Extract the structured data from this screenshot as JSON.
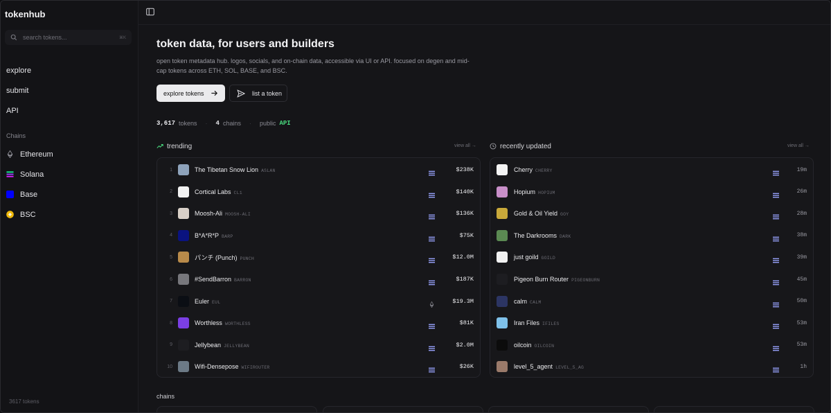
{
  "app": {
    "brand": "tokenhub",
    "footer": "3617 tokens"
  },
  "search": {
    "placeholder": "search tokens...",
    "shortcut": "⌘K"
  },
  "nav": [
    {
      "label": "explore"
    },
    {
      "label": "submit"
    },
    {
      "label": "API"
    }
  ],
  "sidebar_chains": {
    "heading": "Chains",
    "items": [
      {
        "label": "Ethereum",
        "icon": "ethereum-icon",
        "color": "#8a8a92"
      },
      {
        "label": "Solana",
        "icon": "solana-icon",
        "color": "#9945ff"
      },
      {
        "label": "Base",
        "icon": "base-icon",
        "color": "#0000ff"
      },
      {
        "label": "BSC",
        "icon": "bsc-icon",
        "color": "#f0b90b"
      }
    ]
  },
  "hero": {
    "title": "token data, for users and builders",
    "description": "open token metadata hub. logos, socials, and on-chain data, accessible via UI or API. focused on degen and mid-cap tokens across ETH, SOL, BASE, and BSC.",
    "primary_button": "explore tokens",
    "secondary_button": "list a token"
  },
  "stats": {
    "tokens_count": "3,617",
    "tokens_label": "tokens",
    "chains_count": "4",
    "chains_label": "chains",
    "public_label": "public",
    "api_label": "API"
  },
  "trending": {
    "title": "trending",
    "view_all": "view all →",
    "rows": [
      {
        "rank": "1",
        "name": "The Tibetan Snow Lion",
        "symbol": "ASLAN",
        "chain": "solana",
        "mcap": "$238K",
        "avatar_color": "#8ea3bb"
      },
      {
        "rank": "2",
        "name": "Cortical Labs",
        "symbol": "CL1",
        "chain": "solana",
        "mcap": "$140K",
        "avatar_color": "#f2f2f2"
      },
      {
        "rank": "3",
        "name": "Moosh-Ali",
        "symbol": "MOOSH-ALI",
        "chain": "solana",
        "mcap": "$136K",
        "avatar_color": "#d9d0c8"
      },
      {
        "rank": "4",
        "name": "B*A*R*P",
        "symbol": "BARP",
        "chain": "solana",
        "mcap": "$75K",
        "avatar_color": "#0a1380"
      },
      {
        "rank": "5",
        "name": "パンチ (Punch)",
        "symbol": "PUNCH",
        "chain": "solana",
        "mcap": "$12.0M",
        "avatar_color": "#b88a4a"
      },
      {
        "rank": "6",
        "name": "#SendBarron",
        "symbol": "BARRON",
        "chain": "solana",
        "mcap": "$187K",
        "avatar_color": "#77777c"
      },
      {
        "rank": "7",
        "name": "Euler",
        "symbol": "EUL",
        "chain": "ethereum",
        "mcap": "$19.3M",
        "avatar_color": "#0b0e14"
      },
      {
        "rank": "8",
        "name": "Worthless",
        "symbol": "WORTHLESS",
        "chain": "solana",
        "mcap": "$81K",
        "avatar_color": "#7b3fe4"
      },
      {
        "rank": "9",
        "name": "Jellybean",
        "symbol": "JELLYBEAN",
        "chain": "solana",
        "mcap": "$2.0M",
        "avatar_color": "#1d1d21"
      },
      {
        "rank": "10",
        "name": "Wifi-Densepose",
        "symbol": "WIFIROUTER",
        "chain": "solana",
        "mcap": "$26K",
        "avatar_color": "#6c7a86"
      }
    ]
  },
  "recent": {
    "title": "recently updated",
    "view_all": "view all →",
    "rows": [
      {
        "name": "Cherry",
        "symbol": "CHERRY",
        "chain": "solana",
        "ago": "19m",
        "avatar_color": "#f4f4f4"
      },
      {
        "name": "Hopium",
        "symbol": "HOPIUM",
        "chain": "solana",
        "ago": "26m",
        "avatar_color": "#c98fc9"
      },
      {
        "name": "Gold & Oil Yield",
        "symbol": "GOY",
        "chain": "solana",
        "ago": "28m",
        "avatar_color": "#c9a93a"
      },
      {
        "name": "The Darkrooms",
        "symbol": "DARK",
        "chain": "solana",
        "ago": "38m",
        "avatar_color": "#5b8a52"
      },
      {
        "name": "just goild",
        "symbol": "GOILD",
        "chain": "solana",
        "ago": "39m",
        "avatar_color": "#f2f2f2"
      },
      {
        "name": "Pigeon Burn Router",
        "symbol": "PIGEONBURN",
        "chain": "solana",
        "ago": "45m",
        "avatar_color": "#1d1d21"
      },
      {
        "name": "calm",
        "symbol": "CALM",
        "chain": "solana",
        "ago": "50m",
        "avatar_color": "#2c3563"
      },
      {
        "name": "Iran Files",
        "symbol": "IFILES",
        "chain": "solana",
        "ago": "53m",
        "avatar_color": "#7fc1ea"
      },
      {
        "name": "oilcoin",
        "symbol": "OILCOIN",
        "chain": "solana",
        "ago": "53m",
        "avatar_color": "#0c0c0c"
      },
      {
        "name": "level_5_agent",
        "symbol": "LEVEL_5_AG",
        "chain": "solana",
        "ago": "1h",
        "avatar_color": "#9a7a6a"
      }
    ]
  },
  "chains_section": {
    "title": "chains"
  }
}
